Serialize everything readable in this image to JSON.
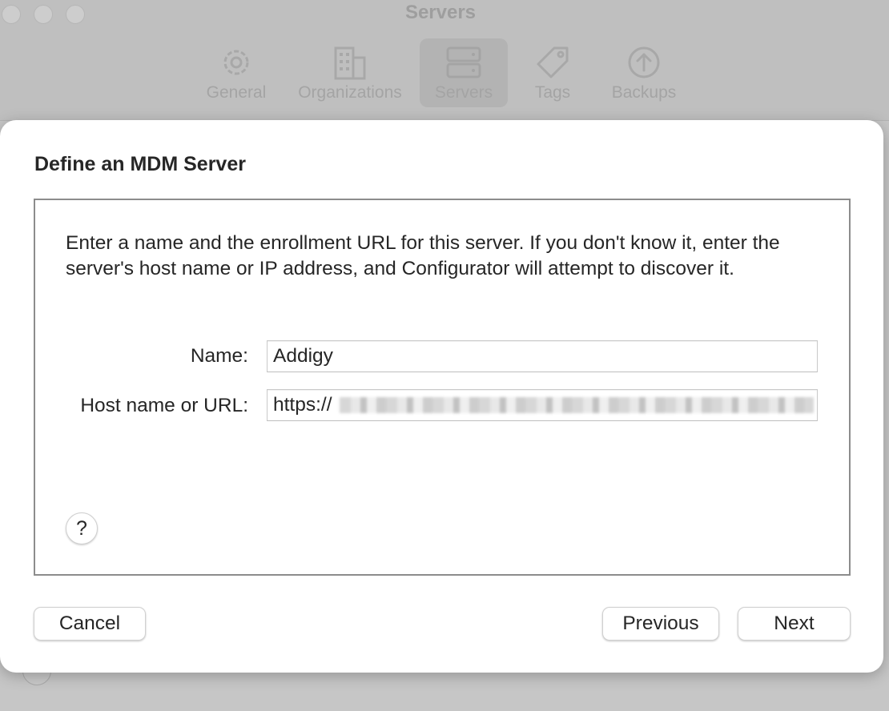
{
  "window": {
    "title": "Servers",
    "toolbar": [
      {
        "label": "General",
        "icon": "gear-icon"
      },
      {
        "label": "Organizations",
        "icon": "building-icon"
      },
      {
        "label": "Servers",
        "icon": "server-icon",
        "selected": true
      },
      {
        "label": "Tags",
        "icon": "tag-icon"
      },
      {
        "label": "Backups",
        "icon": "upload-arrow-icon"
      }
    ]
  },
  "sheet": {
    "title": "Define an MDM Server",
    "instructions": "Enter a name and the enrollment URL for this server. If you don't know it, enter the server's host name or IP address, and Configurator will attempt to discover it.",
    "name_label": "Name:",
    "name_value": "Addigy",
    "url_label": "Host name or URL:",
    "url_value": "https://",
    "help_label": "?",
    "cancel_label": "Cancel",
    "previous_label": "Previous",
    "next_label": "Next"
  }
}
